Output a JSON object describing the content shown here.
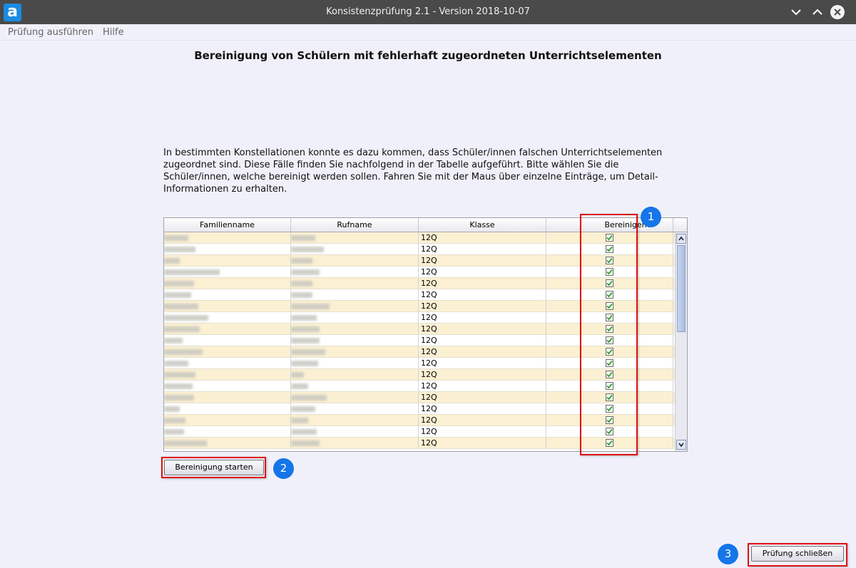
{
  "window": {
    "title": "Konsistenzprüfung 2.1 - Version 2018-10-07",
    "logo_letter": "a"
  },
  "menu": {
    "items": [
      "Prüfung ausführen",
      "Hilfe"
    ]
  },
  "page": {
    "heading": "Bereinigung von Schülern mit fehlerhaft zugeordneten Unterrichtselementen",
    "description": "In bestimmten Konstellationen konnte es dazu kommen, dass Schüler/innen falschen Unterrichtselementen zugeordnet sind. Diese Fälle finden Sie nachfolgend in der Tabelle aufgeführt. Bitte wählen Sie die Schüler/innen, welche bereinigt werden sollen. Fahren Sie mit der Maus über einzelne Einträge, um Detail-Informationen zu erhalten."
  },
  "table": {
    "columns": [
      "Familienname",
      "Rufname",
      "Klasse",
      "Bereinigen?"
    ],
    "rows": [
      {
        "klasse": "12Q",
        "checked": true
      },
      {
        "klasse": "12Q",
        "checked": true
      },
      {
        "klasse": "12Q",
        "checked": true
      },
      {
        "klasse": "12Q",
        "checked": true
      },
      {
        "klasse": "12Q",
        "checked": true
      },
      {
        "klasse": "12Q",
        "checked": true
      },
      {
        "klasse": "12Q",
        "checked": true
      },
      {
        "klasse": "12Q",
        "checked": true
      },
      {
        "klasse": "12Q",
        "checked": true
      },
      {
        "klasse": "12Q",
        "checked": true
      },
      {
        "klasse": "12Q",
        "checked": true
      },
      {
        "klasse": "12Q",
        "checked": true
      },
      {
        "klasse": "12Q",
        "checked": true
      },
      {
        "klasse": "12Q",
        "checked": true
      },
      {
        "klasse": "12Q",
        "checked": true
      },
      {
        "klasse": "12Q",
        "checked": true
      },
      {
        "klasse": "12Q",
        "checked": true
      },
      {
        "klasse": "12Q",
        "checked": true
      },
      {
        "klasse": "12Q",
        "checked": true
      }
    ]
  },
  "buttons": {
    "start_cleanup": "Bereinigung starten",
    "close_check": "Prüfung schließen"
  },
  "annotations": {
    "badge_1": "1",
    "badge_2": "2",
    "badge_3": "3",
    "badge_color": "#1675e8",
    "highlight_color": "#dd1111"
  },
  "colors": {
    "titlebar": "#4a4a4a",
    "background": "#f0f0fa",
    "row_odd": "#fbf0d2",
    "row_even": "#ffffff"
  }
}
